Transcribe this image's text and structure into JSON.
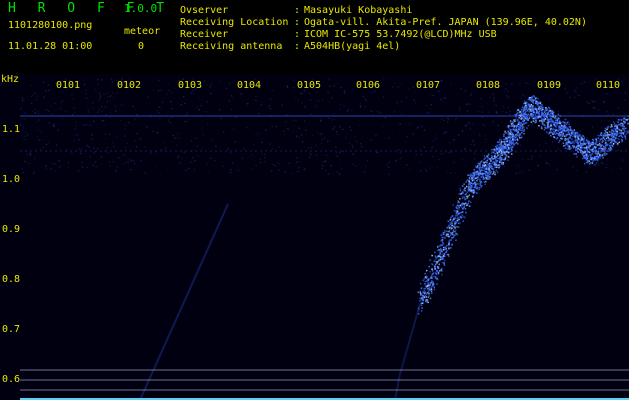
{
  "app": {
    "title": "H R O F F T",
    "version": "1.0.0"
  },
  "file": {
    "name": "1101280100.png",
    "datetime": "11.01.28 01:00"
  },
  "meteor": {
    "label": "meteor",
    "count": "0"
  },
  "info": [
    {
      "label": "Ovserver",
      "sep": ":",
      "value": "Masayuki Kobayashi"
    },
    {
      "label": "Receiving Location",
      "sep": ":",
      "value": "Ogata-vill. Akita-Pref. JAPAN (139.96E, 40.02N)"
    },
    {
      "label": "Receiver",
      "sep": ":",
      "value": "ICOM IC-575 53.7492(@LCD)MHz USB"
    },
    {
      "label": "Receiving antenna",
      "sep": ":",
      "value": "A504HB(yagi 4el)"
    }
  ],
  "spectrogram": {
    "unit_label": "kHz",
    "y_ticks": [
      "1.1",
      "1.0",
      "0.9",
      "0.8",
      "0.7",
      "0.6"
    ],
    "time_ticks": [
      "0101",
      "0102",
      "0103",
      "0104",
      "0105",
      "0106",
      "0107",
      "0108",
      "0109",
      "0110"
    ],
    "colors": {
      "background": "#000010",
      "noise": "#1e2a7a",
      "signal": "#3a6cff",
      "signal_bright": "#9fc4ff",
      "grid_line": "#a0a0c8",
      "baseline": "#60d0f0"
    }
  }
}
